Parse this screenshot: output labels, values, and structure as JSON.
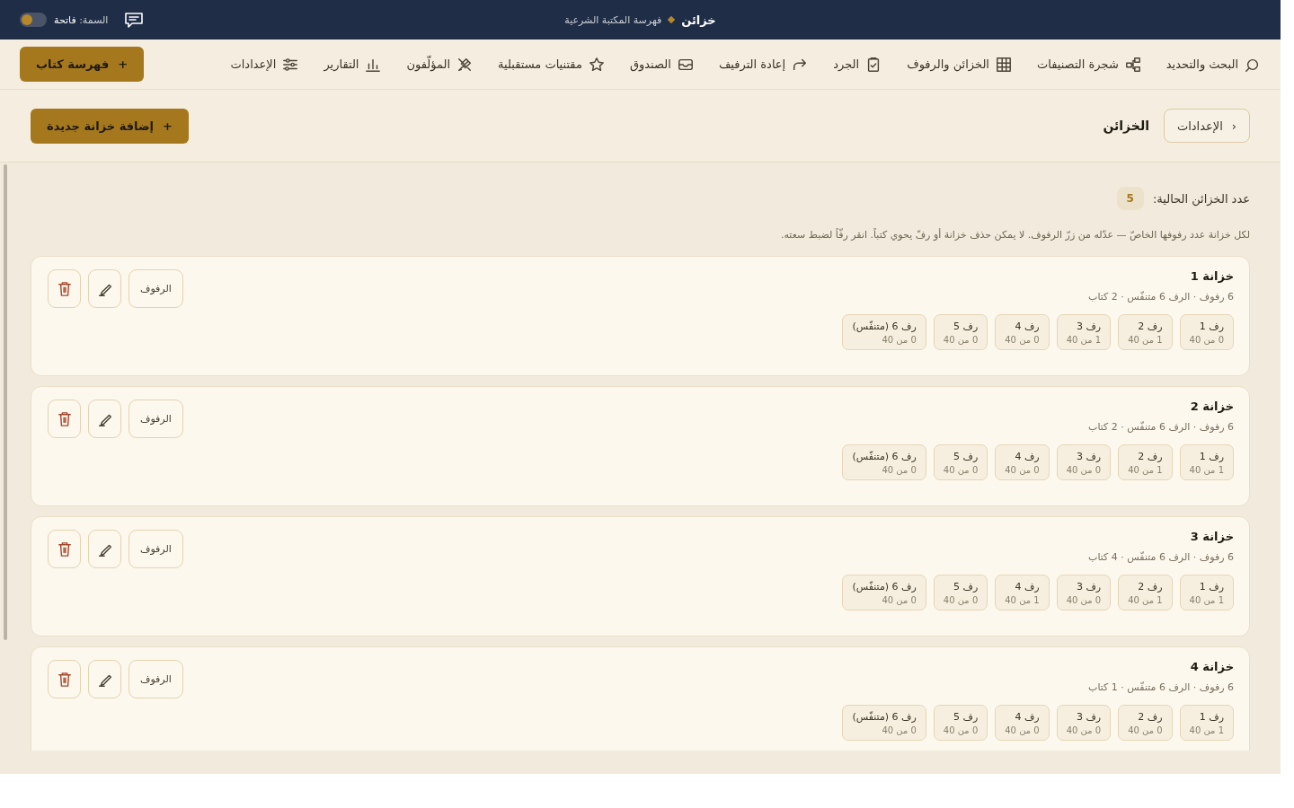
{
  "topbar": {
    "title": "خزائن",
    "subtitle": "فهرسة المكتبة الشرعية",
    "theme_label": "السمة:",
    "theme_value": "فاتحة",
    "theme_toggle": {
      "on": false
    }
  },
  "nav": {
    "items": [
      {
        "label": "البحث والتحديد",
        "kind": "search"
      },
      {
        "label": "شجرة التصنيفات",
        "kind": "tree"
      },
      {
        "label": "الخزائن والرفوف",
        "kind": "grid"
      },
      {
        "label": "الجرد",
        "kind": "clipboard"
      },
      {
        "label": "إعادة الترفيف",
        "kind": "redo"
      },
      {
        "label": "الصندوق",
        "kind": "inbox"
      },
      {
        "label": "مقتنيات مستقبلية",
        "kind": "star"
      },
      {
        "label": "المؤلّفون",
        "kind": "pen"
      },
      {
        "label": "التقارير",
        "kind": "chart"
      },
      {
        "label": "الإعدادات",
        "kind": "sliders"
      }
    ],
    "action_icon": "+",
    "action": "فهرسة كتاب"
  },
  "header": {
    "back_icon": "‹",
    "back": "الإعدادات",
    "title": "الخزائن",
    "add_icon": "+",
    "add_button": "إضافة خزانة جديدة"
  },
  "summary": {
    "label": "عدد الخزائن الحالية:",
    "count": "5",
    "note": "لكل خزانة عدد رفوفها الخاصّ — عدّله من زرّ الرفوف. لا يمكن حذف خزانة أو رفّ يحوي كتباً. انقر رفّاً لضبط سعته."
  },
  "cabinets": [
    {
      "title": "خزانة 1",
      "subtitle": "6 رفوف · الرف 6 متنفّس · 2 كتاب",
      "shelves_button": "الرفوف",
      "shelves": [
        {
          "label": "رف 1",
          "count": "0 من 40"
        },
        {
          "label": "رف 2",
          "count": "1 من 40"
        },
        {
          "label": "رف 3",
          "count": "1 من 40"
        },
        {
          "label": "رف 4",
          "count": "0 من 40"
        },
        {
          "label": "رف 5",
          "count": "0 من 40"
        },
        {
          "label": "رف 6 (متنفّس)",
          "count": "0 من 40"
        }
      ]
    },
    {
      "title": "خزانة 2",
      "subtitle": "6 رفوف · الرف 6 متنفّس · 2 كتاب",
      "shelves_button": "الرفوف",
      "shelves": [
        {
          "label": "رف 1",
          "count": "1 من 40"
        },
        {
          "label": "رف 2",
          "count": "1 من 40"
        },
        {
          "label": "رف 3",
          "count": "0 من 40"
        },
        {
          "label": "رف 4",
          "count": "0 من 40"
        },
        {
          "label": "رف 5",
          "count": "0 من 40"
        },
        {
          "label": "رف 6 (متنفّس)",
          "count": "0 من 40"
        }
      ]
    },
    {
      "title": "خزانة 3",
      "subtitle": "6 رفوف · الرف 6 متنفّس · 4 كتاب",
      "shelves_button": "الرفوف",
      "shelves": [
        {
          "label": "رف 1",
          "count": "1 من 40"
        },
        {
          "label": "رف 2",
          "count": "1 من 40"
        },
        {
          "label": "رف 3",
          "count": "0 من 40"
        },
        {
          "label": "رف 4",
          "count": "1 من 40"
        },
        {
          "label": "رف 5",
          "count": "0 من 40"
        },
        {
          "label": "رف 6 (متنفّس)",
          "count": "0 من 40"
        }
      ]
    },
    {
      "title": "خزانة 4",
      "subtitle": "6 رفوف · الرف 6 متنفّس · 1 كتاب",
      "shelves_button": "الرفوف",
      "shelves": [
        {
          "label": "رف 1",
          "count": "1 من 40"
        },
        {
          "label": "رف 2",
          "count": "0 من 40"
        },
        {
          "label": "رف 3",
          "count": "0 من 40"
        },
        {
          "label": "رف 4",
          "count": "0 من 40"
        },
        {
          "label": "رف 5",
          "count": "0 من 40"
        },
        {
          "label": "رف 6 (متنفّس)",
          "count": "0 من 40"
        }
      ]
    }
  ]
}
